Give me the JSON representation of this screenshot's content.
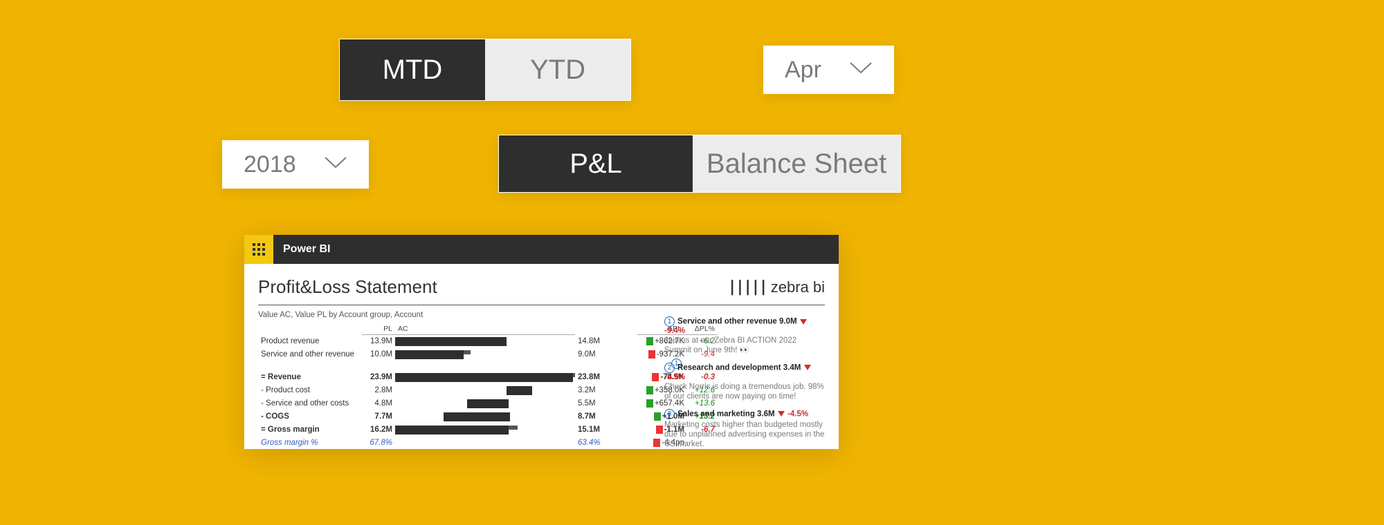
{
  "slicers": {
    "period_toggle": {
      "mtd": "MTD",
      "ytd": "YTD"
    },
    "month": "Apr",
    "year": "2018",
    "view_toggle": {
      "pl": "P&L",
      "bs": "Balance Sheet"
    }
  },
  "powerbi": {
    "app": "Power BI",
    "title": "Profit&Loss Statement",
    "brand": "zebra bi",
    "subtitle": "Value AC, Value PL by Account group, Account",
    "headers": {
      "pl": "PL",
      "ac": "AC",
      "dpl": "ΔPL",
      "dplp": "ΔPL%"
    }
  },
  "rows": [
    {
      "label": "Product revenue",
      "pl": "13.9M",
      "ac": "14.8M",
      "dpl": "+862.7K",
      "dplp": "+6.2",
      "bold": false,
      "plW": 58,
      "acW": 62,
      "pos": true
    },
    {
      "label": "Service and other revenue",
      "pl": "10.0M",
      "ac": "9.0M",
      "dpl": "-937.2K",
      "dplp": "-9.4",
      "bold": false,
      "plW": 42,
      "acW": 38,
      "pos": false,
      "note": 1
    },
    {
      "label": "= Revenue",
      "pl": "23.9M",
      "ac": "23.8M",
      "dpl": "-74.5K",
      "dplp": "-0.3",
      "bold": true,
      "plW": 100,
      "acW": 99,
      "pos": false
    },
    {
      "label": "- Product cost",
      "pl": "2.8M",
      "ac": "3.2M",
      "dpl": "+358.0K",
      "dplp": "+12.6",
      "bold": false,
      "plW": 12,
      "acW": 14,
      "shift": 62,
      "pos": true
    },
    {
      "label": "- Service and other costs",
      "pl": "4.8M",
      "ac": "5.5M",
      "dpl": "+657.4K",
      "dplp": "+13.6",
      "bold": false,
      "plW": 20,
      "acW": 23,
      "shift": 40,
      "pos": true
    },
    {
      "label": "- COGS",
      "pl": "7.7M",
      "ac": "8.7M",
      "dpl": "+1.0M",
      "dplp": "+13.2",
      "bold": true,
      "plW": 32,
      "acW": 37,
      "shift": 27,
      "pos": true
    },
    {
      "label": "= Gross margin",
      "pl": "16.2M",
      "ac": "15.1M",
      "dpl": "-1.1M",
      "dplp": "-6.7",
      "bold": true,
      "plW": 68,
      "acW": 63,
      "pos": false
    },
    {
      "label": "Gross margin %",
      "pl": "67.8%",
      "ac": "63.4%",
      "dpl": "-4.4pp",
      "dplp": "",
      "italic": true,
      "nobar": true,
      "pos": false
    }
  ],
  "comments": [
    {
      "n": "1",
      "title": "Service and other revenue 9.0M",
      "pct": "-9.4%",
      "body": "Join us at our Zebra BI ACTION 2022 Summit on June 9th! 👀"
    },
    {
      "n": "2",
      "title": "Research and development 3.4M",
      "pct": "-5.9%",
      "body": "Chuck Norris is doing a tremendous job. 98% of our clients are now paying on time!"
    },
    {
      "n": "3",
      "title": "Sales and marketing 3.6M",
      "pct": "-4.5%",
      "body": "Marketing costs higher than budgeted mostly due to unplanned advertising expenses in the US market."
    }
  ],
  "chart_data": {
    "type": "bar",
    "title": "Profit&Loss Statement — PL vs AC",
    "categories": [
      "Product revenue",
      "Service and other revenue",
      "Revenue",
      "Product cost",
      "Service and other costs",
      "COGS",
      "Gross margin"
    ],
    "series": [
      {
        "name": "PL",
        "values": [
          13.9,
          10.0,
          23.9,
          2.8,
          4.8,
          7.7,
          16.2
        ]
      },
      {
        "name": "AC",
        "values": [
          14.8,
          9.0,
          23.8,
          3.2,
          5.5,
          8.7,
          15.1
        ]
      }
    ],
    "delta_abs": [
      "+862.7K",
      "-937.2K",
      "-74.5K",
      "+358.0K",
      "+657.4K",
      "+1.0M",
      "-1.1M"
    ],
    "delta_pct": [
      6.2,
      -9.4,
      -0.3,
      12.6,
      13.6,
      13.2,
      -6.7
    ],
    "unit": "M",
    "gross_margin_pct": {
      "pl": 67.8,
      "ac": 63.4,
      "delta": "-4.4pp"
    }
  }
}
